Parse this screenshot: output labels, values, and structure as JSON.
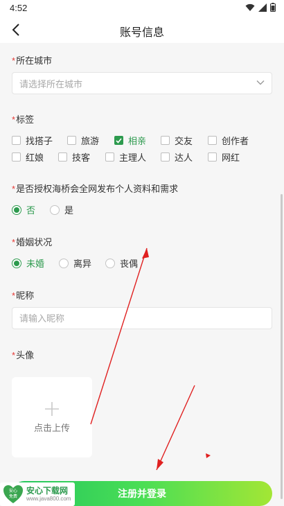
{
  "status_bar": {
    "time": "4:52"
  },
  "nav": {
    "title": "账号信息"
  },
  "city": {
    "label": "所在城市",
    "placeholder": "请选择所在城市"
  },
  "tags": {
    "label": "标签",
    "options": [
      {
        "label": "找搭子",
        "checked": false
      },
      {
        "label": "旅游",
        "checked": false
      },
      {
        "label": "相亲",
        "checked": true
      },
      {
        "label": "交友",
        "checked": false
      },
      {
        "label": "创作者",
        "checked": false
      },
      {
        "label": "红娘",
        "checked": false
      },
      {
        "label": "技客",
        "checked": false
      },
      {
        "label": "主理人",
        "checked": false
      },
      {
        "label": "达人",
        "checked": false
      },
      {
        "label": "网红",
        "checked": false
      }
    ]
  },
  "authorize": {
    "label": "是否授权海桥会全网发布个人资料和需求",
    "options": [
      {
        "label": "否",
        "selected": true
      },
      {
        "label": "是",
        "selected": false
      }
    ]
  },
  "marital": {
    "label": "婚姻状况",
    "options": [
      {
        "label": "未婚",
        "selected": true
      },
      {
        "label": "离异",
        "selected": false
      },
      {
        "label": "丧偶",
        "selected": false
      }
    ]
  },
  "nickname": {
    "label": "昵称",
    "placeholder": "请输入昵称"
  },
  "avatar": {
    "label": "头像",
    "upload_label": "点击上传"
  },
  "submit": {
    "label": "注册并登录"
  },
  "watermark": {
    "main": "安心下载网",
    "sub": "www.java800.com",
    "badge_top": "安心",
    "badge_bottom": "免费"
  },
  "colors": {
    "accent": "#2d9a4e",
    "required": "#e53935",
    "annotation_arrow": "#e02020"
  }
}
